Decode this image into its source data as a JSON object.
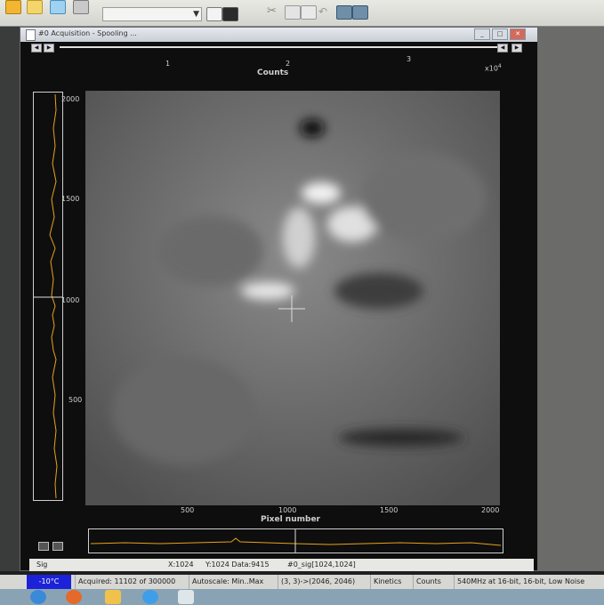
{
  "window": {
    "title": "#0  Acquisition - Spooling ...",
    "controls": [
      "_",
      "□",
      "✕"
    ]
  },
  "plot": {
    "top_axis_label": "Counts",
    "top_axis_scale": "x10",
    "top_axis_exponent": "4",
    "top_ticks": [
      "1",
      "2",
      "3"
    ],
    "x_axis_label": "Pixel number",
    "x_ticks": [
      "500",
      "1000",
      "1500",
      "2000"
    ],
    "y_ticks": [
      "2000",
      "1500",
      "1000",
      "500"
    ]
  },
  "inner_status": {
    "sig": "Sig",
    "x": "X:1024",
    "y_data": "Y:1024  Data:9415",
    "source": "#0_sig[1024,1024]"
  },
  "status_bar": {
    "temperature": "-10°C",
    "acquired": "Acquired: 11102 of 300000",
    "autoscale": "Autoscale: Min..Max",
    "region": "(3, 3)->(2046, 2046)",
    "mode": "Kinetics",
    "units": "Counts",
    "readout": "540MHz at 16-bit, 16-bit, Low Noise"
  },
  "colors": {
    "profile_line": "#e8a21e",
    "temperature_bg": "#1c22d8"
  }
}
